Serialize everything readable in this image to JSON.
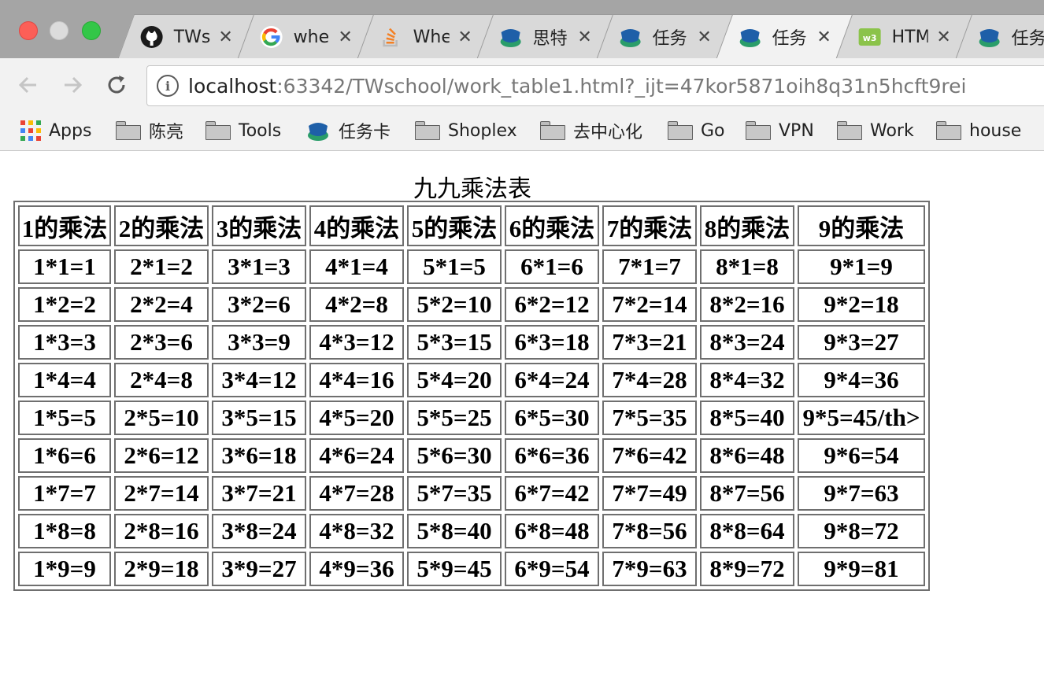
{
  "browser": {
    "tabs": [
      {
        "title": "TWs",
        "icon": "github-icon"
      },
      {
        "title": "whe",
        "icon": "google-icon"
      },
      {
        "title": "Whe",
        "icon": "stackoverflow-icon"
      },
      {
        "title": "思特",
        "icon": "task-card-icon"
      },
      {
        "title": "任务",
        "icon": "task-card-icon"
      },
      {
        "title": "任务",
        "icon": "task-card-icon"
      },
      {
        "title": "HTM",
        "icon": "w3school-icon"
      },
      {
        "title": "任务",
        "icon": "task-card-icon"
      }
    ],
    "tab_close_glyph": "✕",
    "address": {
      "host": "localhost",
      "rest": ":63342/TWschool/work_table1.html?_ijt=47kor5871oih8q31n5hcft9rei"
    },
    "bookmarks": [
      {
        "label": "Apps",
        "icon": "apps-icon"
      },
      {
        "label": "陈亮",
        "icon": "folder-icon"
      },
      {
        "label": "Tools",
        "icon": "folder-icon"
      },
      {
        "label": "任务卡",
        "icon": "task-card-icon"
      },
      {
        "label": "Shoplex",
        "icon": "folder-icon"
      },
      {
        "label": "去中心化",
        "icon": "folder-icon"
      },
      {
        "label": "Go",
        "icon": "folder-icon"
      },
      {
        "label": "VPN",
        "icon": "folder-icon"
      },
      {
        "label": "Work",
        "icon": "folder-icon"
      },
      {
        "label": "house",
        "icon": "folder-icon"
      }
    ],
    "colors": {
      "close_red": "#fc5f57",
      "zoom_green": "#33c748",
      "tabstrip": "#a5a5a5",
      "toolbar": "#f2f2f2"
    }
  },
  "page": {
    "caption": "九九乘法表",
    "headers": [
      "1的乘法",
      "2的乘法",
      "3的乘法",
      "4的乘法",
      "5的乘法",
      "6的乘法",
      "7的乘法",
      "8的乘法",
      "9的乘法"
    ],
    "rows": [
      [
        "1*1=1",
        "2*1=2",
        "3*1=3",
        "4*1=4",
        "5*1=5",
        "6*1=6",
        "7*1=7",
        "8*1=8",
        "9*1=9"
      ],
      [
        "1*2=2",
        "2*2=4",
        "3*2=6",
        "4*2=8",
        "5*2=10",
        "6*2=12",
        "7*2=14",
        "8*2=16",
        "9*2=18"
      ],
      [
        "1*3=3",
        "2*3=6",
        "3*3=9",
        "4*3=12",
        "5*3=15",
        "6*3=18",
        "7*3=21",
        "8*3=24",
        "9*3=27"
      ],
      [
        "1*4=4",
        "2*4=8",
        "3*4=12",
        "4*4=16",
        "5*4=20",
        "6*4=24",
        "7*4=28",
        "8*4=32",
        "9*4=36"
      ],
      [
        "1*5=5",
        "2*5=10",
        "3*5=15",
        "4*5=20",
        "5*5=25",
        "6*5=30",
        "7*5=35",
        "8*5=40",
        "9*5=45/th>"
      ],
      [
        "1*6=6",
        "2*6=12",
        "3*6=18",
        "4*6=24",
        "5*6=30",
        "6*6=36",
        "7*6=42",
        "8*6=48",
        "9*6=54"
      ],
      [
        "1*7=7",
        "2*7=14",
        "3*7=21",
        "4*7=28",
        "5*7=35",
        "6*7=42",
        "7*7=49",
        "8*7=56",
        "9*7=63"
      ],
      [
        "1*8=8",
        "2*8=16",
        "3*8=24",
        "4*8=32",
        "5*8=40",
        "6*8=48",
        "7*8=56",
        "8*8=64",
        "9*8=72"
      ],
      [
        "1*9=9",
        "2*9=18",
        "3*9=27",
        "4*9=36",
        "5*9=45",
        "6*9=54",
        "7*9=63",
        "8*9=72",
        "9*9=81"
      ]
    ]
  }
}
